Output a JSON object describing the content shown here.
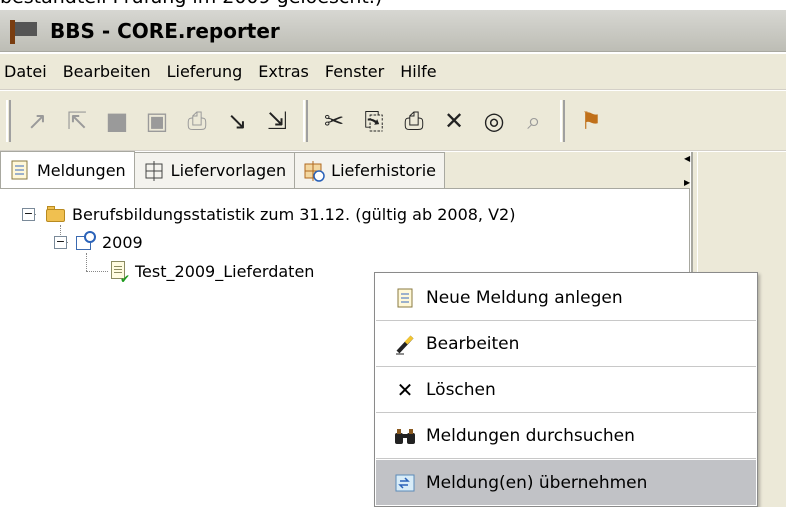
{
  "top_caption": "bestandteil Prüfung im 2009 geloescht.)",
  "window": {
    "title": "BBS - CORE.reporter"
  },
  "menubar": {
    "items": [
      "Datei",
      "Bearbeiten",
      "Lieferung",
      "Extras",
      "Fenster",
      "Hilfe"
    ]
  },
  "tabs": [
    {
      "label": "Meldungen",
      "icon": "document-list-icon"
    },
    {
      "label": "Liefervorlagen",
      "icon": "grid-icon"
    },
    {
      "label": "Lieferhistorie",
      "icon": "history-grid-icon"
    }
  ],
  "tree": {
    "root": {
      "label": "Berufsbildungsstatistik zum 31.12. (gültig ab 2008, V2)"
    },
    "year": {
      "label": "2009"
    },
    "item": {
      "label": "Test_2009_Lieferdaten"
    }
  },
  "context_menu": {
    "items": [
      {
        "label": "Neue Meldung anlegen",
        "icon": "new-document-icon"
      },
      {
        "label": "Bearbeiten",
        "icon": "pen-icon"
      },
      {
        "label": "Löschen",
        "icon": "delete-x-icon"
      },
      {
        "label": "Meldungen durchsuchen",
        "icon": "binoculars-icon"
      },
      {
        "label": "Meldung(en) übernehmen",
        "icon": "import-icon"
      }
    ],
    "highlighted_index": 4
  },
  "colors": {
    "menu_background": "#ece9d8",
    "highlight": "#c1c2c6"
  }
}
